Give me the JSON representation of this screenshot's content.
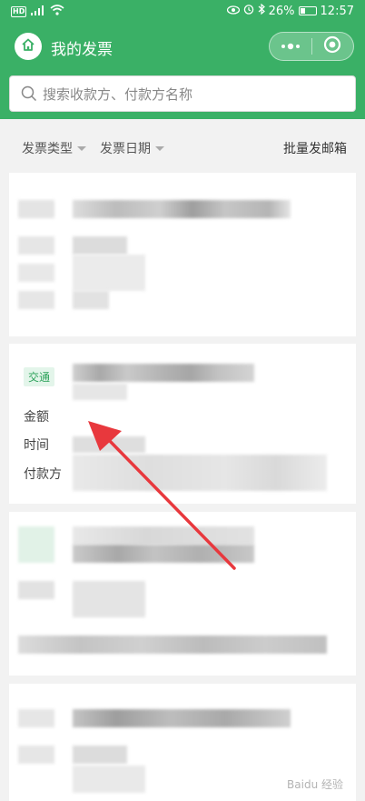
{
  "status_bar": {
    "hd": "HD",
    "signal": "4G",
    "battery": "26%",
    "time": "12:57"
  },
  "nav": {
    "title": "我的发票",
    "more_glyph": "•●•",
    "home_icon": "home-icon",
    "close_icon": "target-icon"
  },
  "search": {
    "placeholder": "搜索收款方、付款方名称"
  },
  "filters": {
    "type_label": "发票类型",
    "date_label": "发票日期",
    "batch_label": "批量发邮箱"
  },
  "invoice_card": {
    "tag": "交通",
    "amount_label": "金额",
    "time_label": "时间",
    "payer_label": "付款方"
  },
  "watermark": "Baidu 经验",
  "colors": {
    "brand_green": "#3ab066",
    "tag_bg": "#e3f5ea",
    "tag_text": "#2fa35c",
    "arrow": "#e8383d"
  }
}
